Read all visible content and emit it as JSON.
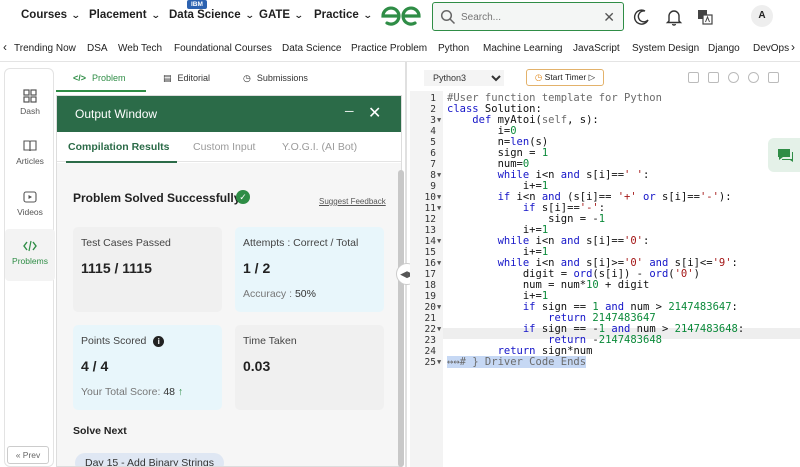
{
  "nav": {
    "items": [
      "Courses",
      "Placement",
      "Data Science",
      "GATE",
      "Practice"
    ],
    "ibm_badge": "IBM",
    "search_placeholder": "Search...",
    "avatar_letter": "A"
  },
  "subnav": {
    "items": [
      "Trending Now",
      "DSA",
      "Web Tech",
      "Foundational Courses",
      "Data Science",
      "Practice Problem",
      "Python",
      "Machine Learning",
      "JavaScript",
      "System Design",
      "Django",
      "DevOps"
    ]
  },
  "sidebar": {
    "items": [
      "Dash",
      "Articles",
      "Videos",
      "Problems"
    ],
    "prev_label": "« Prev"
  },
  "problem_tabs": [
    "Problem",
    "Editorial",
    "Submissions"
  ],
  "output_window": {
    "title": "Output Window",
    "tabs": [
      "Compilation Results",
      "Custom Input",
      "Y.O.G.I. (AI Bot)"
    ],
    "status": "Problem Solved Successfully",
    "feedback_link": "Suggest Feedback",
    "cards": {
      "test_cases_label": "Test Cases Passed",
      "test_cases_value": "1115 / 1115",
      "attempts_label": "Attempts : Correct / Total",
      "attempts_value": "1 / 2",
      "accuracy_label": "Accuracy :",
      "accuracy_value": "50%",
      "points_label": "Points Scored",
      "points_value": "4 / 4",
      "total_score_label": "Your Total Score:",
      "total_score_value": "48",
      "time_label": "Time Taken",
      "time_value": "0.03"
    },
    "solve_next_label": "Solve Next",
    "next_problem": "Day 15 - Add Binary Strings"
  },
  "editor": {
    "language": "Python3",
    "timer_label": "Start Timer",
    "line_numbers": [
      "1",
      "2",
      "3",
      "4",
      "5",
      "6",
      "7",
      "8",
      "9",
      "10",
      "11",
      "12",
      "13",
      "14",
      "15",
      "16",
      "17",
      "18",
      "19",
      "20",
      "21",
      "22",
      "23",
      "24",
      "25"
    ]
  }
}
